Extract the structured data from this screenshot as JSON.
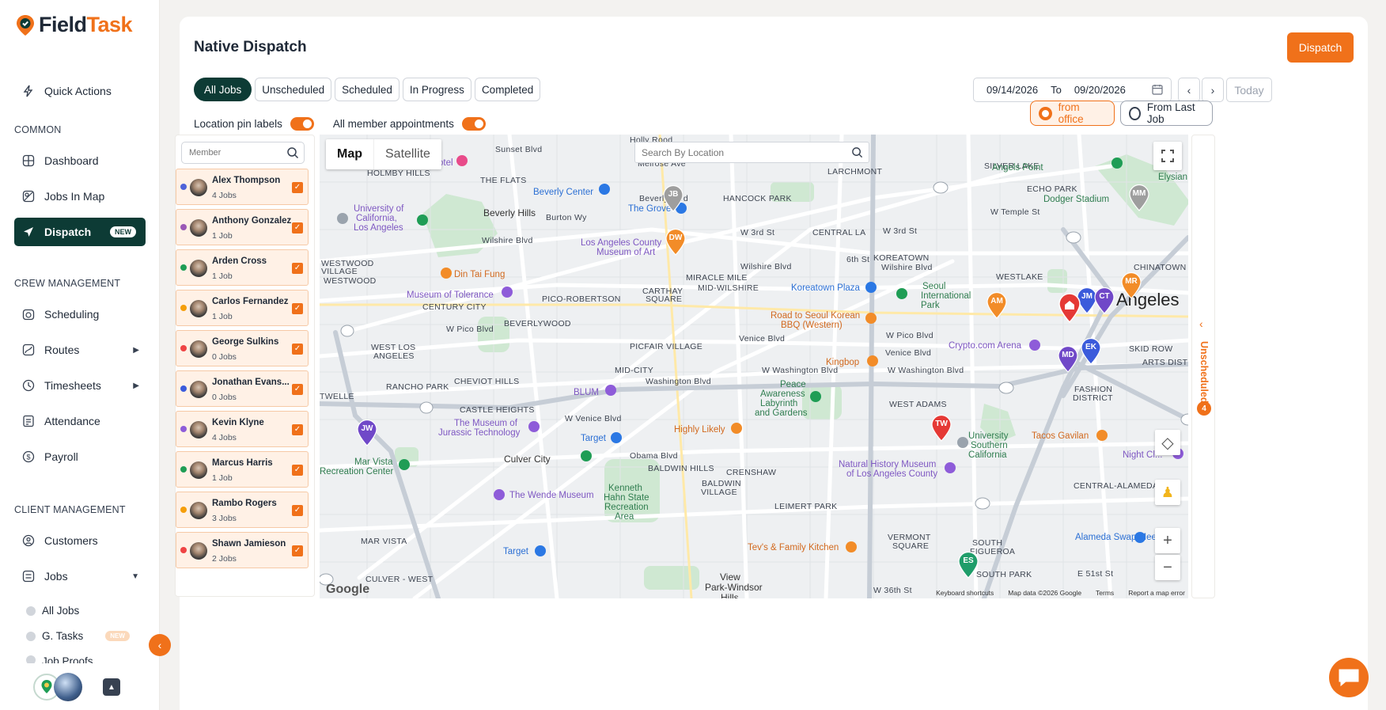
{
  "app": {
    "name_part1": "Field",
    "name_part2": "Task"
  },
  "sidebar": {
    "quick_actions": "Quick Actions",
    "section_common": "COMMON",
    "dashboard": "Dashboard",
    "jobs_in_map": "Jobs In Map",
    "dispatch": "Dispatch",
    "dispatch_badge": "NEW",
    "section_crew": "CREW MANAGEMENT",
    "scheduling": "Scheduling",
    "routes": "Routes",
    "timesheets": "Timesheets",
    "attendance": "Attendance",
    "payroll": "Payroll",
    "section_client": "CLIENT MANAGEMENT",
    "customers": "Customers",
    "jobs": "Jobs",
    "all_jobs": "All Jobs",
    "g_tasks": "G. Tasks",
    "g_tasks_badge": "NEW",
    "job_proofs": "Job Proofs"
  },
  "page": {
    "title": "Native Dispatch",
    "dispatch_button": "Dispatch",
    "tabs": [
      "All Jobs",
      "Unscheduled",
      "Scheduled",
      "In Progress",
      "Completed"
    ],
    "date_from": "09/14/2026",
    "date_to_label": "To",
    "date_to": "09/20/2026",
    "today": "Today",
    "toggle_pin_labels": "Location pin labels",
    "toggle_member_appts": "All member appointments",
    "from_office": "from office",
    "from_last_job": "From Last Job"
  },
  "members": {
    "search_placeholder": "Member",
    "list": [
      {
        "name": "Alex Thompson",
        "jobs": "4 Jobs",
        "dot": "#4f63d9"
      },
      {
        "name": "Anthony Gonzalez",
        "jobs": "1 Job",
        "dot": "#9b59b6"
      },
      {
        "name": "Arden Cross",
        "jobs": "1 Job",
        "dot": "#1f9d55"
      },
      {
        "name": "Carlos Fernandez",
        "jobs": "1 Job",
        "dot": "#f59e0b"
      },
      {
        "name": "George Sulkins",
        "jobs": "0 Jobs",
        "dot": "#ef4444"
      },
      {
        "name": "Jonathan Evans...",
        "jobs": "0 Jobs",
        "dot": "#3b5bdb"
      },
      {
        "name": "Kevin Klyne",
        "jobs": "4 Jobs",
        "dot": "#8e5cd9"
      },
      {
        "name": "Marcus Harris",
        "jobs": "1 Job",
        "dot": "#1f9d55"
      },
      {
        "name": "Rambo Rogers",
        "jobs": "3 Jobs",
        "dot": "#f59e0b"
      },
      {
        "name": "Shawn Jamieson",
        "jobs": "2 Jobs",
        "dot": "#ef4444"
      }
    ]
  },
  "map": {
    "type_map": "Map",
    "type_satellite": "Satellite",
    "search_placeholder": "Search By Location",
    "google": "Google",
    "footer": [
      "Keyboard shortcuts",
      "Map data ©2026 Google",
      "Terms",
      "Report a map error"
    ],
    "labels": {
      "holly": "Holly Rood",
      "sunset": "Sunset Blvd",
      "holmby": "HOLMBY HILLS",
      "flats": "THE FLATS",
      "melrose": "Melrose Ave",
      "beverly_blvd": "Beverly Blvd",
      "larchmont": "LARCHMONT",
      "silverlake": "SILVER LAKE",
      "ucla1": "University of",
      "ucla2": "California,",
      "ucla3": "Los Angeles",
      "beverly_hills": "Beverly Hills",
      "burton": "Burton Wy",
      "hancock": "HANCOCK PARK",
      "echo": "ECHO PARK",
      "wtemple": "W Temple St",
      "wilshire": "Wilshire Blvd",
      "w3rd": "W 3rd St",
      "central": "CENTRAL LA",
      "w3rd2": "W 3rd St",
      "westwood_v1": "WESTWOOD",
      "westwood_v2": "VILLAGE",
      "westwood": "WESTWOOD",
      "wilshire2": "Wilshire Blvd",
      "sixth": "6th St",
      "koreatown": "KOREATOWN",
      "wilshire3": "Wilshire Blvd",
      "chinatown": "CHINATOWN",
      "miracle": "MIRACLE MILE",
      "midwil": "MID-WILSHIRE",
      "westlake": "WESTLAKE",
      "century": "CENTURY CITY",
      "pico_rob": "PICO-ROBERTSON",
      "carthay1": "CARTHAY",
      "carthay2": "SQUARE",
      "seoul1": "Seoul",
      "seoul2": "International",
      "seoul3": "Park",
      "wpico": "W Pico Blvd",
      "beverlywood": "BEVERLYWOOD",
      "venice": "Venice Blvd",
      "wpico2": "W Pico Blvd",
      "venice2": "Venice Blvd",
      "west_la1": "WEST LOS",
      "west_la2": "ANGELES",
      "picfair": "PICFAIR VILLAGE",
      "skid": "SKID ROW",
      "arts": "ARTS DISTRICT",
      "midcity": "MID-CITY",
      "wwash": "W Washington Blvd",
      "washington": "Washington Blvd",
      "wwash2": "W Washington Blvd",
      "rancho": "RANCHO PARK",
      "cheviot": "CHEVIOT HILLS",
      "fashion1": "FASHION",
      "fashion2": "DISTRICT",
      "westadams": "WEST ADAMS",
      "twelle": "TWELLE",
      "castle": "CASTLE HEIGHTS",
      "wvenice": "W Venice Blvd",
      "culver": "Culver City",
      "obama": "Obama Blvd",
      "baldwin_hills": "BALDWIN HILLS",
      "crenshaw": "CRENSHAW",
      "baldwin_v1": "BALDWIN",
      "baldwin_v2": "VILLAGE",
      "leimert": "LEIMERT PARK",
      "mar_vista": "MAR VISTA",
      "culver_west": "CULVER - WEST",
      "vermont1": "VERMONT",
      "vermont2": "SQUARE",
      "south_fig1": "SOUTH",
      "south_fig2": "FIGUEROA",
      "south_park": "SOUTH PARK",
      "central_alameda": "CENTRAL-ALAMEDA",
      "view1": "View",
      "view2": "Park-Windsor",
      "view3": "Hills",
      "w36": "W 36th St",
      "e51": "E 51st St",
      "hotel": "otel",
      "beverly_center": "Beverly Center",
      "the_grove": "The Grove",
      "lacma1": "Los Angeles County",
      "lacma2": "Museum of Art",
      "din_tai": "Din Tai Fung",
      "tolerance": "Museum of Tolerance",
      "koreatown_plaza": "Koreatown Plaza",
      "road_seoul1": "Road to Seoul Korean",
      "road_seoul2": "BBQ (Western)",
      "crypto": "Crypto.com Arena",
      "kingbop": "Kingbop",
      "peace1": "Peace",
      "peace2": "Awareness",
      "peace3": "Labyrinth",
      "peace4": "and Gardens",
      "jurassic1": "The Museum of",
      "jurassic2": "Jurassic Technology",
      "blum": "BLUM",
      "highly": "Highly Likely",
      "target1": "Target",
      "usc1": "University",
      "usc2": "Southern",
      "usc3": "California",
      "tacos": "Tacos Gavilan",
      "night": "Night Cl...",
      "marvista1": "Mar Vista",
      "marvista2": "Recreation Center",
      "nhm1": "Natural History Museum",
      "nhm2": "of Los Angeles County",
      "wende": "The Wende Museum",
      "kenneth1": "Kenneth",
      "kenneth2": "Hahn State",
      "kenneth3": "Recreation",
      "kenneth4": "Area",
      "target2": "Target",
      "tevs": "Tev's & Family Kitchen",
      "alameda_swap": "Alameda Swap Meet",
      "angels_point": "Angels Point",
      "dodger": "Dodger Stadium",
      "elysian": "Elysian Pa",
      "angeles": "Angeles"
    },
    "pins": [
      {
        "label": "JB",
        "color": "#9e9e9e"
      },
      {
        "label": "DW",
        "color": "#f28c28"
      },
      {
        "label": "MM",
        "color": "#9e9e9e"
      },
      {
        "label": "MR",
        "color": "#f28c28"
      },
      {
        "label": "AM",
        "color": "#f28c28"
      },
      {
        "label": "JM",
        "color": "#3b5bdb"
      },
      {
        "label": "CT",
        "color": "#7048c8"
      },
      {
        "label": "EK",
        "color": "#3b5bdb"
      },
      {
        "label": "MD",
        "color": "#7048c8"
      },
      {
        "label": "JW",
        "color": "#7048c8"
      },
      {
        "label": "TW",
        "color": "#e53935"
      },
      {
        "label": "ES",
        "color": "#1f9d6a"
      }
    ]
  },
  "unscheduled": {
    "label": "Unscheduled",
    "count": "4"
  }
}
